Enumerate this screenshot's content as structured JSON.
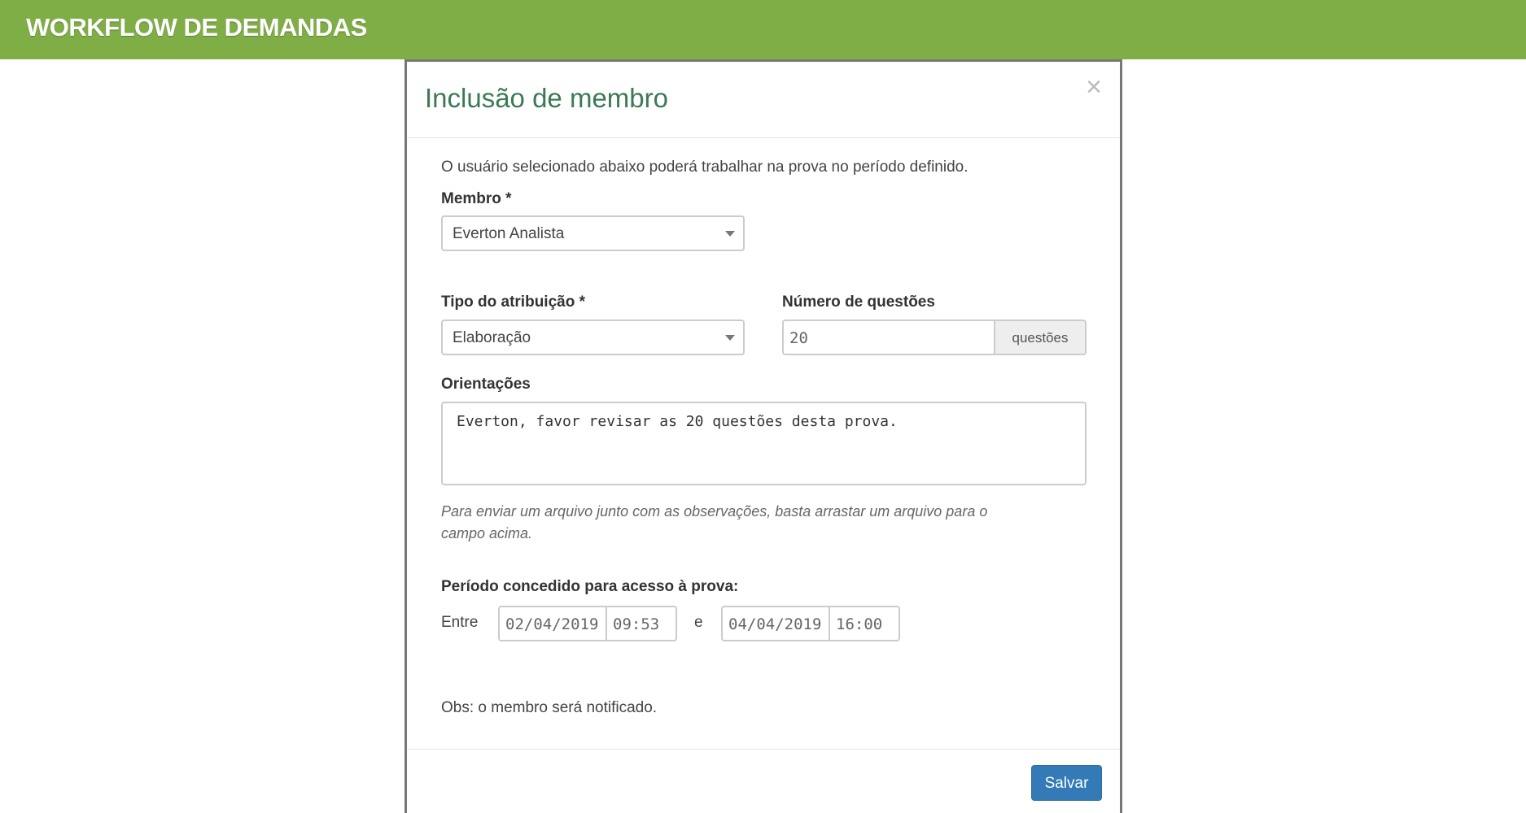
{
  "header": {
    "brand": "WORKFLOW DE DEMANDAS"
  },
  "modal": {
    "title": "Inclusão de membro",
    "close_symbol": "×",
    "intro": "O usuário selecionado abaixo poderá trabalhar na prova no período definido.",
    "member": {
      "label": "Membro *",
      "value": "Everton Analista"
    },
    "assignment_type": {
      "label": "Tipo do atribuição *",
      "value": "Elaboração"
    },
    "question_count": {
      "label": "Número de questões",
      "value": "20",
      "addon": "questões"
    },
    "guidance": {
      "label": "Orientações",
      "value": "Everton, favor revisar as 20 questões desta prova."
    },
    "help_text_line1": "Para enviar um arquivo junto com as observações, basta arrastar um arquivo para o",
    "help_text_line2": "campo acima.",
    "period": {
      "label": "Período concedido para acesso à prova:",
      "between": "Entre",
      "and": "e",
      "start_date": "02/04/2019",
      "start_time": "09:53",
      "end_date": "04/04/2019",
      "end_time": "16:00"
    },
    "note": "Obs: o membro será notificado.",
    "save_label": "Salvar"
  },
  "colors": {
    "topbar": "#7fad46",
    "title": "#3c7a55",
    "primary_button": "#337ab7"
  }
}
